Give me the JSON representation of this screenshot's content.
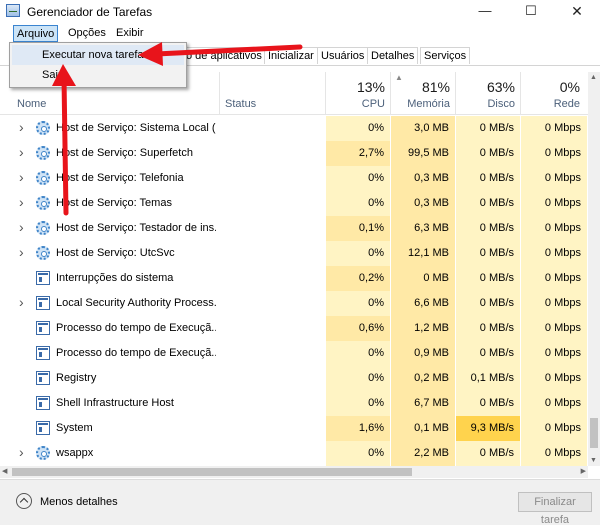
{
  "window": {
    "title": "Gerenciador de Tarefas",
    "minimize_glyph": "—",
    "maximize_glyph": "☐",
    "close_glyph": "✕"
  },
  "menu": {
    "file": "Arquivo",
    "options": "Opções",
    "view": "Exibir"
  },
  "file_menu": {
    "run_new_task": "Executar nova tarefa",
    "exit": "Sair"
  },
  "tabs": [
    {
      "label": "o de aplicativos"
    },
    {
      "label": "Inicializar"
    },
    {
      "label": "Usuários"
    },
    {
      "label": "Detalhes"
    },
    {
      "label": "Serviços"
    }
  ],
  "columns": {
    "name": "Nome",
    "status": "Status",
    "cpu": {
      "percent": "13%",
      "label": "CPU"
    },
    "memory": {
      "percent": "81%",
      "label": "Memória"
    },
    "disk": {
      "percent": "63%",
      "label": "Disco"
    },
    "network": {
      "percent": "0%",
      "label": "Rede"
    }
  },
  "processes": [
    {
      "name": "Host de Serviço: Sistema Local (...",
      "icon": "gear-icon",
      "expandable": true,
      "cpu": "0%",
      "memory": "3,0 MB",
      "disk": "0 MB/s",
      "network": "0 Mbps"
    },
    {
      "name": "Host de Serviço: Superfetch",
      "icon": "gear-icon",
      "expandable": true,
      "cpu": "2,7%",
      "memory": "99,5 MB",
      "disk": "0 MB/s",
      "network": "0 Mbps"
    },
    {
      "name": "Host de Serviço: Telefonia",
      "icon": "gear-icon",
      "expandable": true,
      "cpu": "0%",
      "memory": "0,3 MB",
      "disk": "0 MB/s",
      "network": "0 Mbps"
    },
    {
      "name": "Host de Serviço: Temas",
      "icon": "gear-icon",
      "expandable": true,
      "cpu": "0%",
      "memory": "0,3 MB",
      "disk": "0 MB/s",
      "network": "0 Mbps"
    },
    {
      "name": "Host de Serviço: Testador de ins...",
      "icon": "gear-icon",
      "expandable": true,
      "cpu": "0,1%",
      "memory": "6,3 MB",
      "disk": "0 MB/s",
      "network": "0 Mbps"
    },
    {
      "name": "Host de Serviço: UtcSvc",
      "icon": "gear-icon",
      "expandable": true,
      "cpu": "0%",
      "memory": "12,1 MB",
      "disk": "0 MB/s",
      "network": "0 Mbps"
    },
    {
      "name": "Interrupções do sistema",
      "icon": "window-app-icon",
      "expandable": false,
      "cpu": "0,2%",
      "memory": "0 MB",
      "disk": "0 MB/s",
      "network": "0 Mbps"
    },
    {
      "name": "Local Security Authority Process...",
      "icon": "window-app-icon",
      "expandable": true,
      "cpu": "0%",
      "memory": "6,6 MB",
      "disk": "0 MB/s",
      "network": "0 Mbps"
    },
    {
      "name": "Processo do tempo de Execuçã...",
      "icon": "window-app-icon",
      "expandable": false,
      "cpu": "0,6%",
      "memory": "1,2 MB",
      "disk": "0 MB/s",
      "network": "0 Mbps"
    },
    {
      "name": "Processo do tempo de Execuçã...",
      "icon": "window-app-icon",
      "expandable": false,
      "cpu": "0%",
      "memory": "0,9 MB",
      "disk": "0 MB/s",
      "network": "0 Mbps"
    },
    {
      "name": "Registry",
      "icon": "window-app-icon",
      "expandable": false,
      "cpu": "0%",
      "memory": "0,2 MB",
      "disk": "0,1 MB/s",
      "network": "0 Mbps"
    },
    {
      "name": "Shell Infrastructure Host",
      "icon": "window-app-icon",
      "expandable": false,
      "cpu": "0%",
      "memory": "6,7 MB",
      "disk": "0 MB/s",
      "network": "0 Mbps"
    },
    {
      "name": "System",
      "icon": "window-app-icon",
      "expandable": false,
      "cpu": "1,6%",
      "memory": "0,1 MB",
      "disk": "9,3 MB/s",
      "network": "0 Mbps",
      "disk_highlight": true
    },
    {
      "name": "wsappx",
      "icon": "gear-icon",
      "expandable": true,
      "cpu": "0%",
      "memory": "2,2 MB",
      "disk": "0 MB/s",
      "network": "0 Mbps"
    }
  ],
  "footer": {
    "fewer_details": "Menos detalhes",
    "end_task": "Finalizar tarefa"
  },
  "colors": {
    "heat_light": "#fff4c4",
    "heat_medium": "#ffe9a6",
    "heat_high": "#ffd34d",
    "annotation_arrow": "#e8141b"
  }
}
